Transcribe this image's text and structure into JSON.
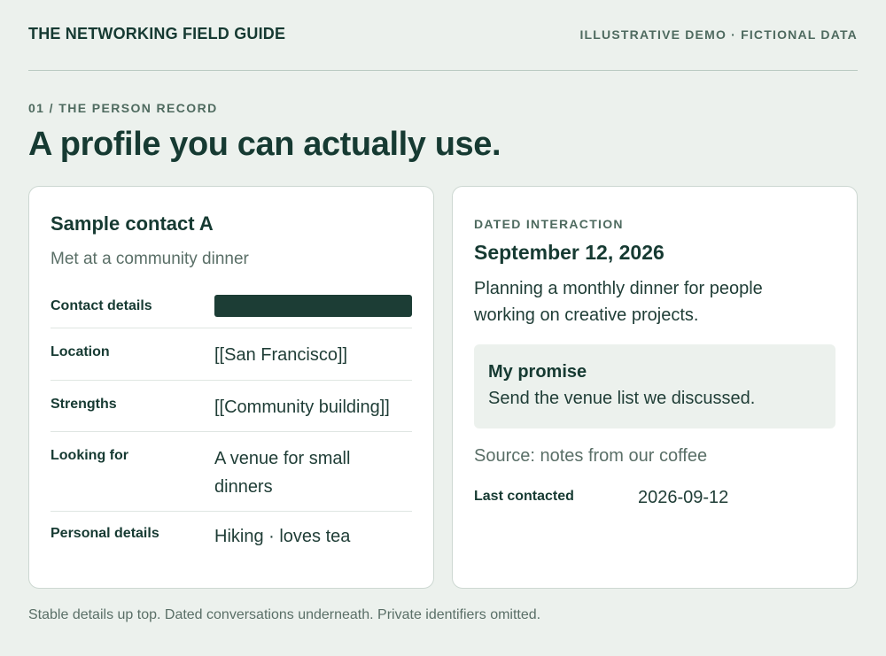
{
  "header": {
    "brand": "THE NETWORKING FIELD GUIDE",
    "tagline": "ILLUSTRATIVE DEMO · FICTIONAL DATA"
  },
  "section": {
    "eyebrow": "01 / THE PERSON RECORD",
    "title": "A profile you can actually use."
  },
  "profile": {
    "name": "Sample contact A",
    "subtitle": "Met at a community dinner",
    "fields": {
      "contact_details": {
        "label": "Contact details"
      },
      "location": {
        "label": "Location",
        "value": "[[San Francisco]]"
      },
      "strengths": {
        "label": "Strengths",
        "value": "[[Community building]]"
      },
      "looking_for": {
        "label": "Looking for",
        "value": "A venue for small dinners"
      },
      "personal_details": {
        "label": "Personal details",
        "value": "Hiking · loves tea"
      }
    }
  },
  "interaction": {
    "eyebrow": "DATED INTERACTION",
    "date": "September 12, 2026",
    "summary": "Planning a monthly dinner for people working on creative projects.",
    "promise": {
      "title": "My promise",
      "text": "Send the venue list we discussed."
    },
    "source": "Source: notes from our coffee",
    "last_contacted": {
      "label": "Last contacted",
      "value": "2026-09-12"
    }
  },
  "footnote": "Stable details up top. Dated conversations underneath. Private identifiers omitted.",
  "colors": {
    "page_background": "#ecf1ed",
    "ink": "#163a32",
    "muted": "#5a6f67",
    "redaction_bar": "#1c3d35"
  }
}
